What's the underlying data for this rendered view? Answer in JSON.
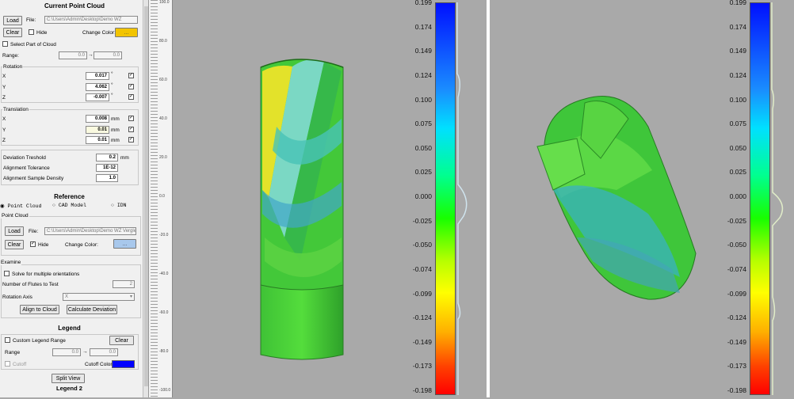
{
  "panel": {
    "current_cloud": {
      "title": "Current Point Cloud",
      "load": "Load",
      "file_label": "File:",
      "file_path": "C:\\Users\\Admin\\Desktop\\Demo WZ",
      "clear": "Clear",
      "hide": "Hide",
      "change_color": "Change Color:",
      "color_btn": "...",
      "select_part": "Select Part of Cloud",
      "range_label": "Range:",
      "range_from": "0.0",
      "range_arrow": "→",
      "range_to": "0.0",
      "rotation_title": "Rotation",
      "rotation": [
        {
          "axis": "X",
          "value": "0.017",
          "unit": "°"
        },
        {
          "axis": "Y",
          "value": "4.062",
          "unit": "°"
        },
        {
          "axis": "Z",
          "value": "-0.007",
          "unit": "°"
        }
      ],
      "translation_title": "Translation",
      "translation": [
        {
          "axis": "X",
          "value": "0.008",
          "unit": "mm"
        },
        {
          "axis": "Y",
          "value": "0.01",
          "unit": "mm"
        },
        {
          "axis": "Z",
          "value": "0.01",
          "unit": "mm"
        }
      ],
      "dev_label": "Deviation Treshold",
      "dev_value": "0.2",
      "dev_unit": "mm",
      "tol_label": "Alignment Tolerance",
      "tol_value": "1E-12",
      "dens_label": "Alignment Sample Density",
      "dens_value": "1.0"
    },
    "reference": {
      "title": "Reference",
      "opt_point": "Point Cloud",
      "opt_cad": "CAD Model",
      "opt_idn": "IDN",
      "group": "Point Cloud",
      "load": "Load",
      "file_label": "File:",
      "file_path": "C:\\Users\\Admin\\Desktop\\Demo WZ Vergleic",
      "clear": "Clear",
      "hide": "Hide",
      "change_color": "Change Color:",
      "color_btn": "..."
    },
    "examine": {
      "title": "Examine",
      "solve": "Solve for multiple orientations",
      "flutes_label": "Number of Flutes to Test",
      "flutes_value": "2",
      "axis_label": "Rotation Axis",
      "axis_value": "X",
      "align": "Align to Cloud",
      "calc": "Calculate Deviation"
    },
    "legend": {
      "title": "Legend",
      "custom": "Custom Legend Range",
      "clear": "Clear",
      "range_label": "Range",
      "range_from": "0.0",
      "range_arrow": "→",
      "range_to": "0.0",
      "cutoff": "Cutoff",
      "cutoff_color": "Cutoff Color:",
      "split": "Split View",
      "legend2": "Legend 2"
    }
  },
  "ruler": {
    "labels": [
      "100.0",
      "80.0",
      "60.0",
      "40.0",
      "20.0",
      "0.0",
      "-20.0",
      "-40.0",
      "-60.0",
      "-80.0",
      "-100.0"
    ]
  },
  "scale_labels": [
    "0.199",
    "0.174",
    "0.149",
    "0.124",
    "0.100",
    "0.075",
    "0.050",
    "0.025",
    "0.000",
    "-0.025",
    "-0.050",
    "-0.074",
    "-0.099",
    "-0.124",
    "-0.149",
    "-0.173",
    "-0.198"
  ],
  "colors": {
    "current_color": "#f2c400",
    "reference_color": "#a8c8ec",
    "cutoff_color": "#0000ff"
  }
}
